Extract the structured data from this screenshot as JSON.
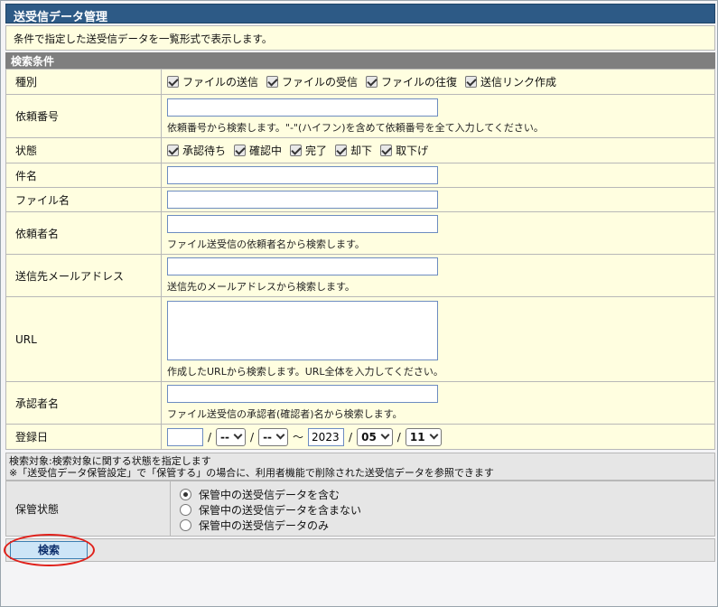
{
  "title": "送受信データ管理",
  "description": "条件で指定した送受信データを一覧形式で表示します。",
  "section_title": "検索条件",
  "fields": {
    "type": {
      "label": "種別",
      "options": [
        "ファイルの送信",
        "ファイルの受信",
        "ファイルの往復",
        "送信リンク作成"
      ]
    },
    "request_no": {
      "label": "依頼番号",
      "value": "",
      "hint": "依頼番号から検索します。\"-\"(ハイフン)を含めて依頼番号を全て入力してください。"
    },
    "status": {
      "label": "状態",
      "options": [
        "承認待ち",
        "確認中",
        "完了",
        "却下",
        "取下げ"
      ]
    },
    "subject": {
      "label": "件名",
      "value": ""
    },
    "filename": {
      "label": "ファイル名",
      "value": ""
    },
    "requester": {
      "label": "依頼者名",
      "value": "",
      "hint": "ファイル送受信の依頼者名から検索します。"
    },
    "dest_mail": {
      "label": "送信先メールアドレス",
      "value": "",
      "hint": "送信先のメールアドレスから検索します。"
    },
    "url": {
      "label": "URL",
      "value": "",
      "hint": "作成したURLから検索します。URL全体を入力してください。"
    },
    "approver": {
      "label": "承認者名",
      "value": "",
      "hint": "ファイル送受信の承認者(確認者)名から検索します。"
    },
    "reg_date": {
      "label": "登録日",
      "from_year": "",
      "from_month": "--",
      "from_day": "--",
      "tilde": "～",
      "sep": "/",
      "to_year": "2023",
      "to_month": "05",
      "to_day": "11"
    }
  },
  "note": {
    "line1": "検索対象:検索対象に関する状態を指定します",
    "line2": "※「送受信データ保管設定」で「保管する」の場合に、利用者機能で削除された送受信データを参照できます"
  },
  "storage": {
    "label": "保管状態",
    "options": [
      "保管中の送受信データを含む",
      "保管中の送受信データを含まない",
      "保管中の送受信データのみ"
    ],
    "selected": 0
  },
  "search_button": "検索",
  "colors": {
    "title_bg": "#2d5a86",
    "row_bg": "#fffee0",
    "section_bg": "#7f7f7f",
    "highlight": "#e0201a"
  }
}
